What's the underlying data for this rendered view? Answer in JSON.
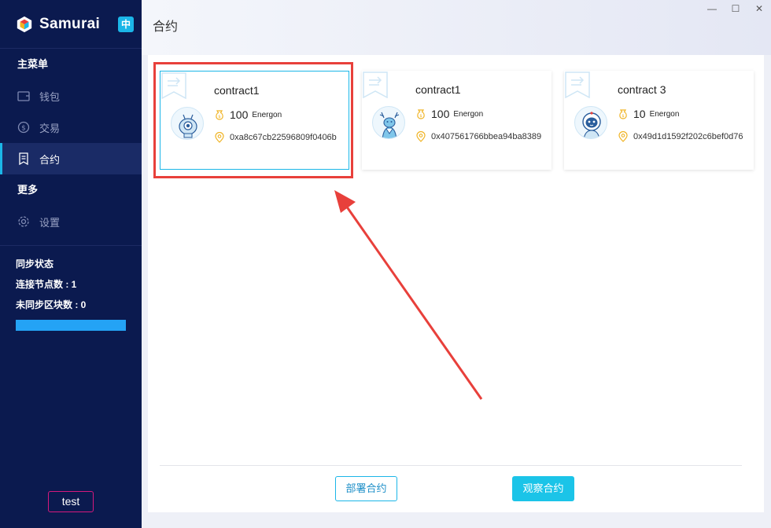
{
  "app": {
    "name": "Samurai",
    "lang_toggle": "中"
  },
  "sidebar": {
    "main_menu_title": "主菜单",
    "items": [
      {
        "label": "钱包",
        "icon": "wallet-icon",
        "active": false
      },
      {
        "label": "交易",
        "icon": "dollar-icon",
        "active": false
      },
      {
        "label": "合约",
        "icon": "contract-icon",
        "active": true
      }
    ],
    "more_title": "更多",
    "more_items": [
      {
        "label": "设置",
        "icon": "gear-icon"
      }
    ],
    "sync": {
      "title": "同步状态",
      "peers": "连接节点数 : 1",
      "unsynced": "未同步区块数 : 0",
      "progress": 1.0
    },
    "user_label": "test"
  },
  "header": {
    "title": "合约"
  },
  "window_controls": {
    "minimize": "—",
    "maximize": "☐",
    "close": "✕"
  },
  "contracts": [
    {
      "name": "contract1",
      "amount": "100",
      "unit": "Energon",
      "address": "0xa8c67cb22596809f0406b",
      "avatar": "robot-eye-avatar",
      "selected": true
    },
    {
      "name": "contract1",
      "amount": "100",
      "unit": "Energon",
      "address": "0x407561766bbea94ba8389",
      "avatar": "deer-avatar",
      "selected": false
    },
    {
      "name": "contract 3",
      "amount": "10",
      "unit": "Energon",
      "address": "0x49d1d1592f202c6bef0d76",
      "avatar": "astronaut-avatar",
      "selected": false
    }
  ],
  "actions": {
    "deploy": "部署合约",
    "watch": "观察合约"
  },
  "colors": {
    "sidebar": "#0b1a4f",
    "accent": "#1bb6e8",
    "annotation": "#e8403b",
    "coin": "#f0b323"
  }
}
